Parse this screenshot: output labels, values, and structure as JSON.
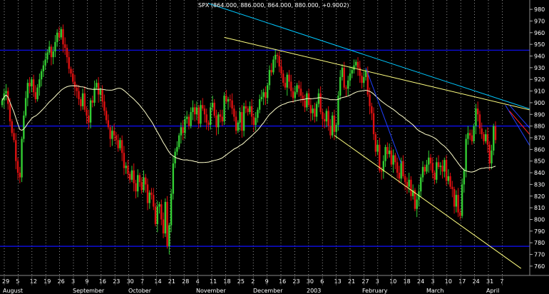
{
  "chart_data": {
    "type": "candlestick",
    "title": "SPX (864.000, 886.000, 864.000, 880.000, +0.9002)",
    "ylim": [
      752,
      988
    ],
    "y_ticks": [
      760,
      770,
      780,
      790,
      800,
      810,
      820,
      830,
      840,
      850,
      860,
      870,
      880,
      890,
      900,
      910,
      920,
      930,
      940,
      950,
      960,
      970,
      980
    ],
    "x_day_labels": [
      "29",
      "5",
      "12",
      "19",
      "26",
      "3",
      "9",
      "16",
      "23",
      "30",
      "7",
      "14",
      "21",
      "28",
      "4",
      "11",
      "18",
      "25",
      "2",
      "9",
      "16",
      "23",
      "30",
      "6",
      "13",
      "21",
      "27",
      "3",
      "10",
      "18",
      "24",
      "3",
      "10",
      "17",
      "24",
      "31",
      "7"
    ],
    "months": [
      "August",
      "September",
      "October",
      "November",
      "December",
      "2003",
      "February",
      "March",
      "April"
    ],
    "horizontal_levels": [
      945,
      880,
      777
    ],
    "closes": [
      902,
      908,
      910,
      899,
      884,
      874,
      868,
      850,
      840,
      836,
      869,
      889,
      904,
      917,
      914,
      920,
      909,
      903,
      913,
      920,
      927,
      932,
      937,
      943,
      948,
      939,
      944,
      952,
      960,
      956,
      963,
      950,
      947,
      939,
      929,
      925,
      918,
      913,
      910,
      903,
      897,
      908,
      894,
      889,
      883,
      902,
      900,
      913,
      917,
      907,
      911,
      901,
      893,
      885,
      879,
      869,
      876,
      872,
      868,
      861,
      868,
      857,
      844,
      846,
      839,
      834,
      842,
      831,
      824,
      838,
      832,
      825,
      836,
      830,
      814,
      823,
      821,
      811,
      796,
      811,
      813,
      800,
      788,
      815,
      777,
      795,
      822,
      848,
      858,
      862,
      872,
      879,
      874,
      886,
      888,
      880,
      892,
      896,
      890,
      896,
      882,
      898,
      895,
      890,
      883,
      881,
      896,
      900,
      889,
      879,
      890,
      888,
      884,
      906,
      901,
      903,
      902,
      895,
      888,
      876,
      883,
      892,
      876,
      897,
      895,
      892,
      897,
      888,
      881,
      887,
      894,
      903,
      905,
      909,
      904,
      915,
      928,
      926,
      937,
      941,
      940,
      931,
      925,
      917,
      913,
      924,
      918,
      910,
      904,
      909,
      915,
      912,
      906,
      902,
      896,
      908,
      898,
      891,
      895,
      888,
      899,
      908,
      892,
      886,
      884,
      893,
      880,
      872,
      889,
      875,
      881,
      906,
      922,
      930,
      913,
      912,
      919,
      925,
      928,
      932,
      935,
      930,
      923,
      917,
      922,
      927,
      907,
      897,
      891,
      873,
      858,
      864,
      842,
      841,
      850,
      862,
      856,
      859,
      847,
      855,
      849,
      840,
      835,
      850,
      837,
      832,
      828,
      834,
      820,
      825,
      809,
      817,
      824,
      836,
      845,
      841,
      847,
      853,
      848,
      840,
      834,
      849,
      845,
      846,
      841,
      851,
      833,
      837,
      828,
      826,
      811,
      821,
      806,
      803,
      830,
      842,
      869,
      874,
      872,
      867,
      880,
      895,
      890,
      878,
      873,
      867,
      873,
      864,
      848,
      859,
      880,
      868
    ],
    "ma_label": "moving average",
    "lines": [
      {
        "name": "upper channel cyan",
        "color": "#00c8ff"
      },
      {
        "name": "upper channel yellow",
        "color": "#ffff80"
      },
      {
        "name": "lower channel yellow",
        "color": "#ffff80"
      },
      {
        "name": "down trend blue",
        "color": "#2040ff"
      },
      {
        "name": "wedge blue",
        "color": "#2040ff"
      }
    ]
  }
}
